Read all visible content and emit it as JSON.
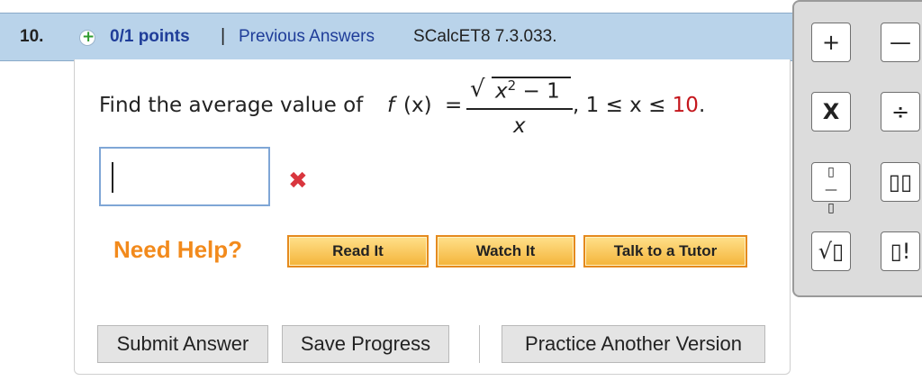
{
  "header": {
    "number": "10.",
    "points": "0/1 points",
    "separator": "|",
    "previous_answers": "Previous Answers",
    "reference": "SCalcET8 7.3.033."
  },
  "question": {
    "prompt": "Find the average value of",
    "func_name": "f",
    "func_arg": "(x)",
    "equals": "=",
    "numerator_base": "x",
    "numerator_exp": "2",
    "numerator_rest": " − 1",
    "denominator": "x",
    "range_prefix": ", 1 ≤ x ≤ ",
    "range_upper": "10",
    "range_suffix": "."
  },
  "answer": {
    "value": "",
    "status_icon": "x-mark-icon"
  },
  "help": {
    "label": "Need Help?",
    "buttons": [
      "Read It",
      "Watch It",
      "Talk to a Tutor"
    ]
  },
  "actions": {
    "submit": "Submit Answer",
    "save": "Save Progress",
    "practice": "Practice Another Version"
  },
  "palette": {
    "keys": [
      "+",
      "—",
      "X",
      "÷",
      "▯/▯",
      "▯▯",
      "√▯",
      "▯!"
    ]
  },
  "colors": {
    "header_bg": "#b9d3ea",
    "link": "#1f3d99",
    "help_orange": "#f28a1c",
    "error_red": "#d9363e",
    "range_red": "#c4161c"
  }
}
